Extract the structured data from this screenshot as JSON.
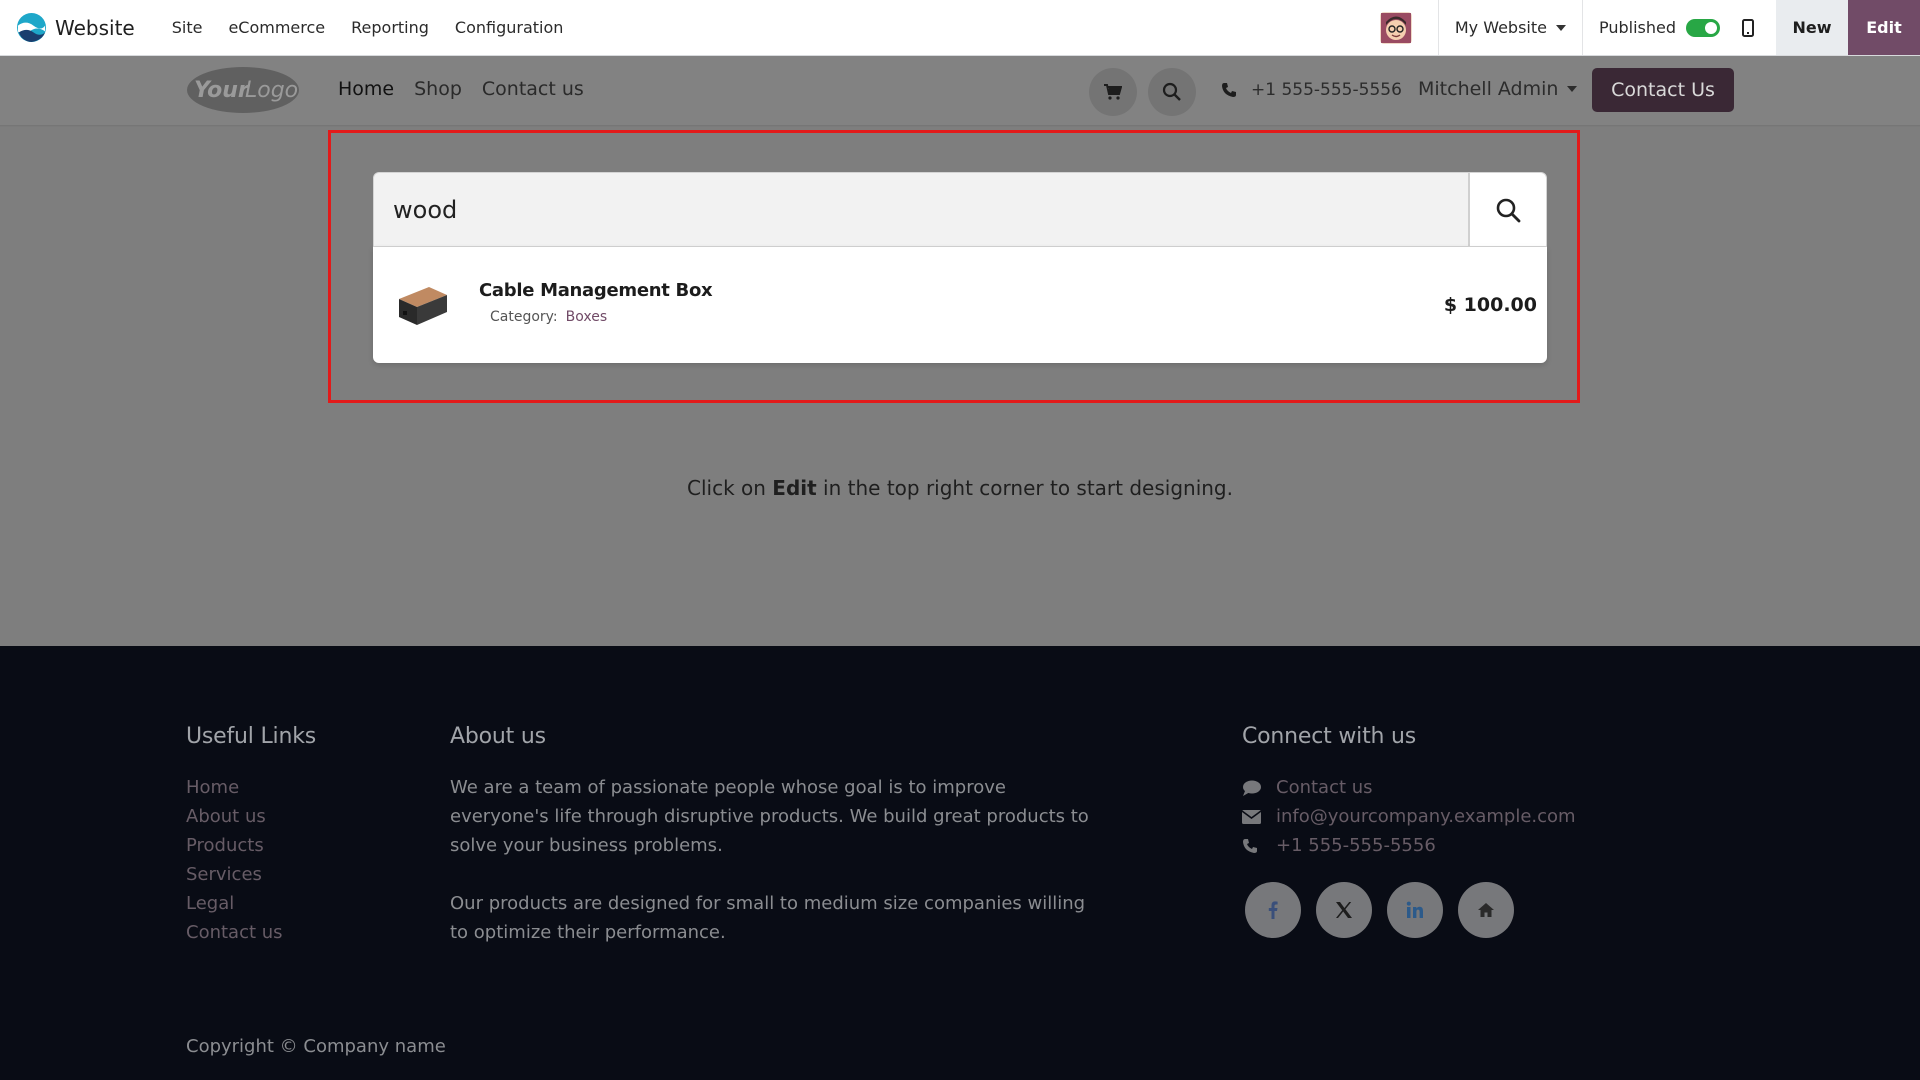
{
  "topbar": {
    "app_name": "Website",
    "menu": [
      "Site",
      "eCommerce",
      "Reporting",
      "Configuration"
    ],
    "website_selector": "My Website",
    "published_label": "Published",
    "published": true,
    "new_label": "New",
    "edit_label": "Edit",
    "edit_color": "#714b67"
  },
  "site_header": {
    "nav": [
      "Home",
      "Shop",
      "Contact us"
    ],
    "phone": "+1 555-555-5556",
    "user": "Mitchell Admin",
    "contact_button": "Contact Us"
  },
  "main": {
    "hint_before": "Click on ",
    "hint_bold": "Edit",
    "hint_after": " in the top right corner to start designing."
  },
  "search": {
    "value": "wood",
    "results": [
      {
        "name": "Cable Management Box",
        "category_label": "Category:",
        "category": "Boxes",
        "price": "$ 100.00"
      }
    ]
  },
  "footer": {
    "useful_links_title": "Useful Links",
    "useful_links": [
      "Home",
      "About us",
      "Products",
      "Services",
      "Legal",
      "Contact us"
    ],
    "about_title": "About us",
    "about_p1": "We are a team of passionate people whose goal is to improve everyone's life through disruptive products. We build great products to solve your business problems.",
    "about_p2": "Our products are designed for small to medium size companies willing to optimize their performance.",
    "connect_title": "Connect with us",
    "connect_contact": "Contact us",
    "connect_email": "info@yourcompany.example.com",
    "connect_phone": "+1 555-555-5556",
    "social_icons": [
      "facebook-icon",
      "x-twitter-icon",
      "linkedin-icon",
      "home-icon"
    ],
    "copyright": "Copyright © Company name"
  }
}
